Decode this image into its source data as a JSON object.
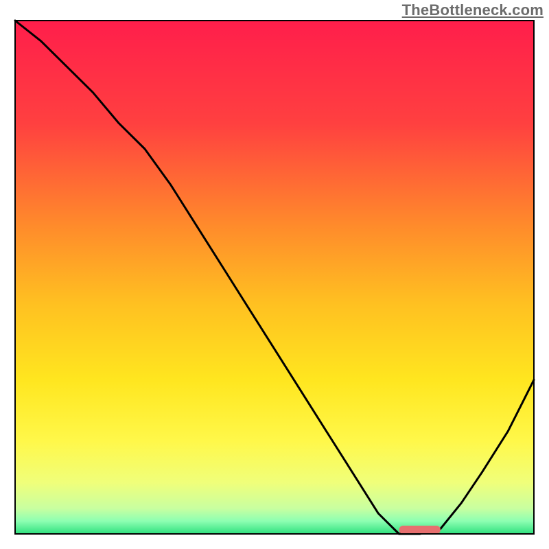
{
  "watermark": "TheBottleneck.com",
  "chart_data": {
    "type": "line",
    "title": "",
    "xlabel": "",
    "ylabel": "",
    "xlim": [
      0,
      100
    ],
    "ylim": [
      0,
      100
    ],
    "axes_visible": false,
    "background_gradient": {
      "stops": [
        {
          "offset": 0.0,
          "color": "#ff1e4b"
        },
        {
          "offset": 0.2,
          "color": "#ff4040"
        },
        {
          "offset": 0.4,
          "color": "#ff8b2b"
        },
        {
          "offset": 0.55,
          "color": "#ffc021"
        },
        {
          "offset": 0.7,
          "color": "#ffe61f"
        },
        {
          "offset": 0.82,
          "color": "#fff84a"
        },
        {
          "offset": 0.9,
          "color": "#f0ff7a"
        },
        {
          "offset": 0.95,
          "color": "#c9ffa0"
        },
        {
          "offset": 0.975,
          "color": "#8dffb2"
        },
        {
          "offset": 1.0,
          "color": "#2fe07e"
        }
      ]
    },
    "series": [
      {
        "name": "bottleneck-curve",
        "color": "#000000",
        "type": "line",
        "x": [
          0,
          5,
          10,
          15,
          20,
          25,
          30,
          35,
          40,
          45,
          50,
          55,
          60,
          65,
          70,
          74,
          78,
          82,
          86,
          90,
          95,
          100
        ],
        "y": [
          100,
          96,
          91,
          86,
          80,
          75,
          68,
          60,
          52,
          44,
          36,
          28,
          20,
          12,
          4,
          0,
          0,
          1,
          6,
          12,
          20,
          30
        ]
      }
    ],
    "marker": {
      "name": "optimal-range",
      "color": "#e76f6f",
      "x_start": 74,
      "x_end": 82,
      "y": 0,
      "thickness": 2
    },
    "frame": {
      "visible": true,
      "color": "#000000",
      "width": 2
    }
  }
}
